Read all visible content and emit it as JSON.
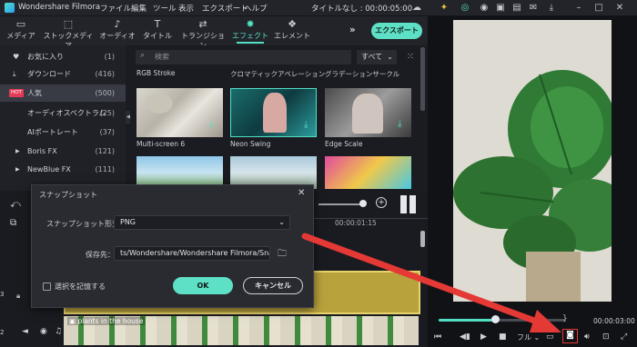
{
  "app": {
    "name": "Wondershare Filmora",
    "menus": [
      "ファイル",
      "編集",
      "ツール",
      "表示",
      "エクスポート",
      "ヘルプ"
    ],
    "project_title": "タイトルなし : 00:00:05:00"
  },
  "toolbar": {
    "items": [
      "メディア",
      "ストックメディア",
      "オーディオ",
      "タイトル",
      "トランジション",
      "エフェクト",
      "エレメント"
    ],
    "active": "エフェクト",
    "export_label": "エクスポート"
  },
  "sidebar": {
    "items": [
      {
        "label": "お気に入り",
        "count": "(1)",
        "icon": "heart-icon"
      },
      {
        "label": "ダウンロード",
        "count": "(416)",
        "icon": "download-icon"
      },
      {
        "label": "人気",
        "count": "(500)",
        "badge": "HOT",
        "selected": true
      },
      {
        "label": "オーディオスペクトラム",
        "count": "(25)"
      },
      {
        "label": "AIポートレート",
        "count": "(37)"
      },
      {
        "label": "Boris FX",
        "count": "(121)"
      },
      {
        "label": "NewBlue FX",
        "count": "(111)"
      }
    ]
  },
  "effects": {
    "search_placeholder": "検索",
    "filter": "すべて",
    "top_labels": [
      "RGB Stroke",
      "クロマティックアベレーション",
      "グラデーションサークル"
    ],
    "row2_labels": [
      "Multi-screen 6",
      "Neon Swing",
      "Edge Scale"
    ]
  },
  "dialog": {
    "title": "スナップショット",
    "format_label": "スナップショット形式：",
    "format_value": "PNG",
    "save_label": "保存先：",
    "save_path": "ts/Wondershare/Wondershare Filmora/Snapshot",
    "remember_label": "選択を記憶する",
    "ok_label": "OK",
    "cancel_label": "キャンセル"
  },
  "timeline": {
    "time_mark": "00:00:01:15",
    "clip_label": "plants in the house",
    "track_numbers": [
      "3",
      "2"
    ]
  },
  "preview": {
    "timecode": "00:00:03:00",
    "quality": "フル",
    "progress": 0.45
  },
  "colors": {
    "accent": "#52e0c4",
    "arrow": "#e53935",
    "hot": "#e33a55"
  }
}
